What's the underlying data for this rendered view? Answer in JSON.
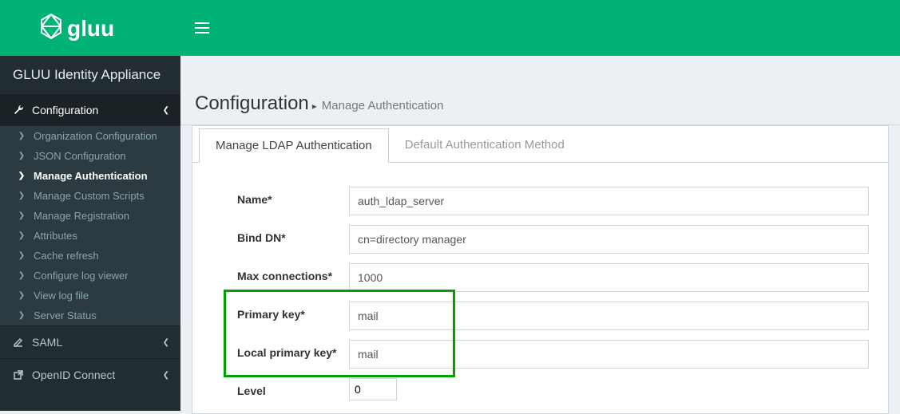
{
  "appTitle": "GLUU Identity Appliance",
  "breadcrumb": {
    "title": "Configuration",
    "sub": "Manage Authentication"
  },
  "sidebar": {
    "configLabel": "Configuration",
    "items": [
      {
        "label": "Organization Configuration"
      },
      {
        "label": "JSON Configuration"
      },
      {
        "label": "Manage Authentication"
      },
      {
        "label": "Manage Custom Scripts"
      },
      {
        "label": "Manage Registration"
      },
      {
        "label": "Attributes"
      },
      {
        "label": "Cache refresh"
      },
      {
        "label": "Configure log viewer"
      },
      {
        "label": "View log file"
      },
      {
        "label": "Server Status"
      }
    ],
    "saml": "SAML",
    "openid": "OpenID Connect"
  },
  "tabs": [
    {
      "label": "Manage LDAP Authentication"
    },
    {
      "label": "Default Authentication Method"
    }
  ],
  "form": {
    "name": {
      "label": "Name*",
      "value": "auth_ldap_server"
    },
    "bindDn": {
      "label": "Bind DN*",
      "value": "cn=directory manager"
    },
    "maxConn": {
      "label": "Max connections*",
      "value": "1000"
    },
    "primaryKey": {
      "label": "Primary key*",
      "value": "mail"
    },
    "localPrimaryKey": {
      "label": "Local primary key*",
      "value": "mail"
    },
    "level": {
      "label": "Level",
      "value": "0"
    }
  }
}
